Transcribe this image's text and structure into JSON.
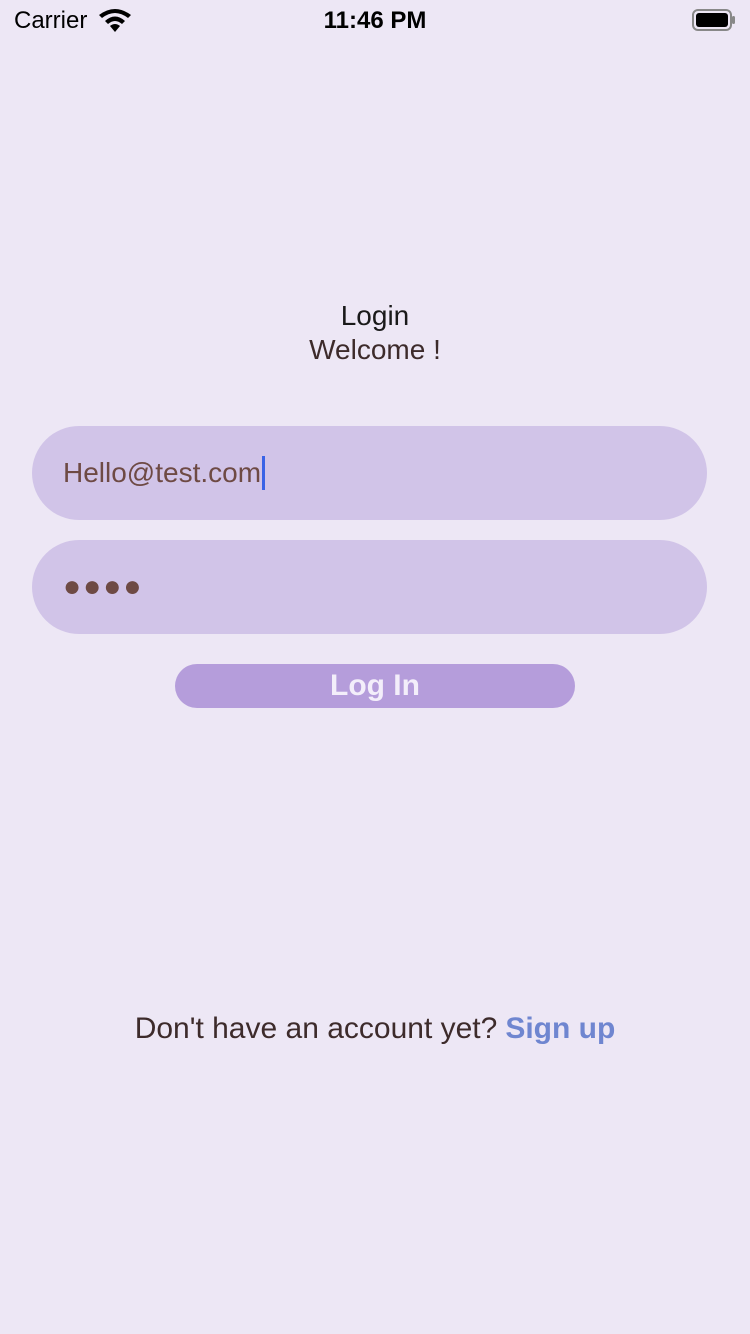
{
  "status_bar": {
    "carrier": "Carrier",
    "time": "11:46 PM",
    "icons": [
      "wifi-icon",
      "battery-icon"
    ]
  },
  "header": {
    "title": "Login",
    "subtitle": "Welcome !"
  },
  "form": {
    "email_value": "Hello@test.com",
    "password_mask": "●●●●",
    "login_label": "Log In"
  },
  "footer": {
    "prompt": "Don't have an account yet?",
    "signup_label": "Sign up"
  },
  "colors": {
    "background": "#ede7f5",
    "field": "#d1c4e8",
    "button": "#b59ddb",
    "link": "#6f86d0",
    "caret": "#3a63e6"
  }
}
